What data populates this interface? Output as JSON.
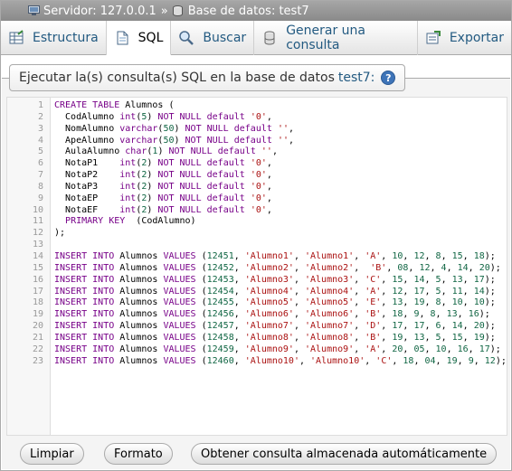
{
  "breadcrumb": {
    "server_label": "Servidor: 127.0.0.1",
    "separator": "»",
    "database_label": "Base de datos: test7"
  },
  "tabs": [
    {
      "label": "Estructura",
      "icon": "structure-icon"
    },
    {
      "label": "SQL",
      "icon": "sql-icon",
      "active": true
    },
    {
      "label": "Buscar",
      "icon": "search-icon"
    },
    {
      "label": "Generar una consulta",
      "icon": "query-icon"
    },
    {
      "label": "Exportar",
      "icon": "export-icon"
    }
  ],
  "fieldset": {
    "title_prefix": "Ejecutar la(s) consulta(s) SQL en la base de datos",
    "database": "test7:",
    "help_glyph": "?"
  },
  "editor": {
    "lines": [
      {
        "n": "1",
        "text": "CREATE TABLE Alumnos ("
      },
      {
        "n": "2",
        "text": "  CodAlumno int(5) NOT NULL default '0',"
      },
      {
        "n": "3",
        "text": "  NomAlumno varchar(50) NOT NULL default '',"
      },
      {
        "n": "4",
        "text": "  ApeAlumno varchar(50) NOT NULL default '',"
      },
      {
        "n": "5",
        "text": "  AulaAlumno char(1) NOT NULL default '',"
      },
      {
        "n": "6",
        "text": "  NotaP1    int(2) NOT NULL default '0',"
      },
      {
        "n": "7",
        "text": "  NotaP2    int(2) NOT NULL default '0',"
      },
      {
        "n": "8",
        "text": "  NotaP3    int(2) NOT NULL default '0',"
      },
      {
        "n": "9",
        "text": "  NotaEP    int(2) NOT NULL default '0',"
      },
      {
        "n": "10",
        "text": "  NotaEF    int(2) NOT NULL default '0',"
      },
      {
        "n": "11",
        "text": "  PRIMARY KEY  (CodAlumno)"
      },
      {
        "n": "12",
        "text": ");"
      },
      {
        "n": "13",
        "text": ""
      },
      {
        "n": "14",
        "text": "INSERT INTO Alumnos VALUES (12451, 'Alumno1', 'Alumno1', 'A', 10, 12, 8, 15, 18);"
      },
      {
        "n": "15",
        "text": "INSERT INTO Alumnos VALUES (12452, 'Alumno2', 'Alumno2',  'B', 08, 12, 4, 14, 20);"
      },
      {
        "n": "16",
        "text": "INSERT INTO Alumnos VALUES (12453, 'Alumno3', 'Alumno3', 'C', 15, 14, 5, 13, 17);"
      },
      {
        "n": "17",
        "text": "INSERT INTO Alumnos VALUES (12454, 'Alumno4', 'Alumno4', 'A', 12, 17, 5, 11, 14);"
      },
      {
        "n": "18",
        "text": "INSERT INTO Alumnos VALUES (12455, 'Alumno5', 'Alumno5', 'E', 13, 19, 8, 10, 10);"
      },
      {
        "n": "19",
        "text": "INSERT INTO Alumnos VALUES (12456, 'Alumno6', 'Alumno6', 'B', 18, 9, 8, 13, 16);"
      },
      {
        "n": "20",
        "text": "INSERT INTO Alumnos VALUES (12457, 'Alumno7', 'Alumno7', 'D', 17, 17, 6, 14, 20);"
      },
      {
        "n": "21",
        "text": "INSERT INTO Alumnos VALUES (12458, 'Alumno8', 'Alumno8', 'B', 19, 13, 5, 15, 19);"
      },
      {
        "n": "22",
        "text": "INSERT INTO Alumnos VALUES (12459, 'Alumno9', 'Alumno9', 'A', 20, 05, 10, 16, 17);"
      },
      {
        "n": "23",
        "text": "INSERT INTO Alumnos VALUES (12460, 'Alumno10', 'Alumno10', 'C', 18, 04, 19, 9, 12);"
      }
    ]
  },
  "buttons": {
    "clear": "Limpiar",
    "format": "Formato",
    "get_stored": "Obtener consulta almacenada automáticamente"
  },
  "colors": {
    "keyword": "#770088",
    "string": "#aa1111",
    "number": "#116644",
    "link": "#235a81"
  }
}
